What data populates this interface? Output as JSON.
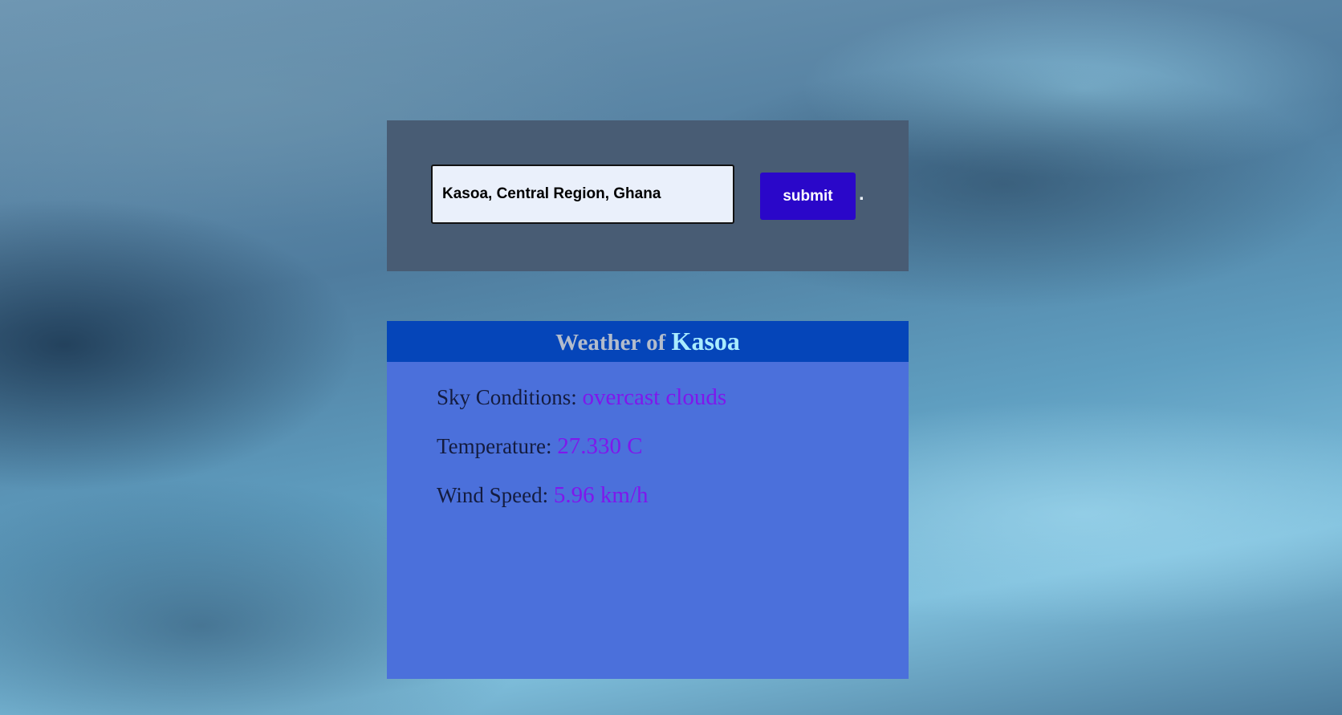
{
  "search": {
    "input_value": "Kasoa, Central Region, Ghana",
    "submit_label": "submit",
    "trailing_text": "."
  },
  "weather": {
    "header_prefix": "Weather of",
    "city": "Kasoa",
    "rows": [
      {
        "label": "Sky Conditions:",
        "value": "overcast clouds"
      },
      {
        "label": "Temperature:",
        "value": "27.330 C"
      },
      {
        "label": "Wind Speed:",
        "value": "5.96 km/h"
      }
    ]
  },
  "colors": {
    "search_panel_bg": "#485c74",
    "submit_bg": "#2a07c9",
    "card_header_bg": "#0545b9",
    "card_body_bg": "#4b70db",
    "value_text": "#7f17ec",
    "city_text": "#a9ecff"
  }
}
